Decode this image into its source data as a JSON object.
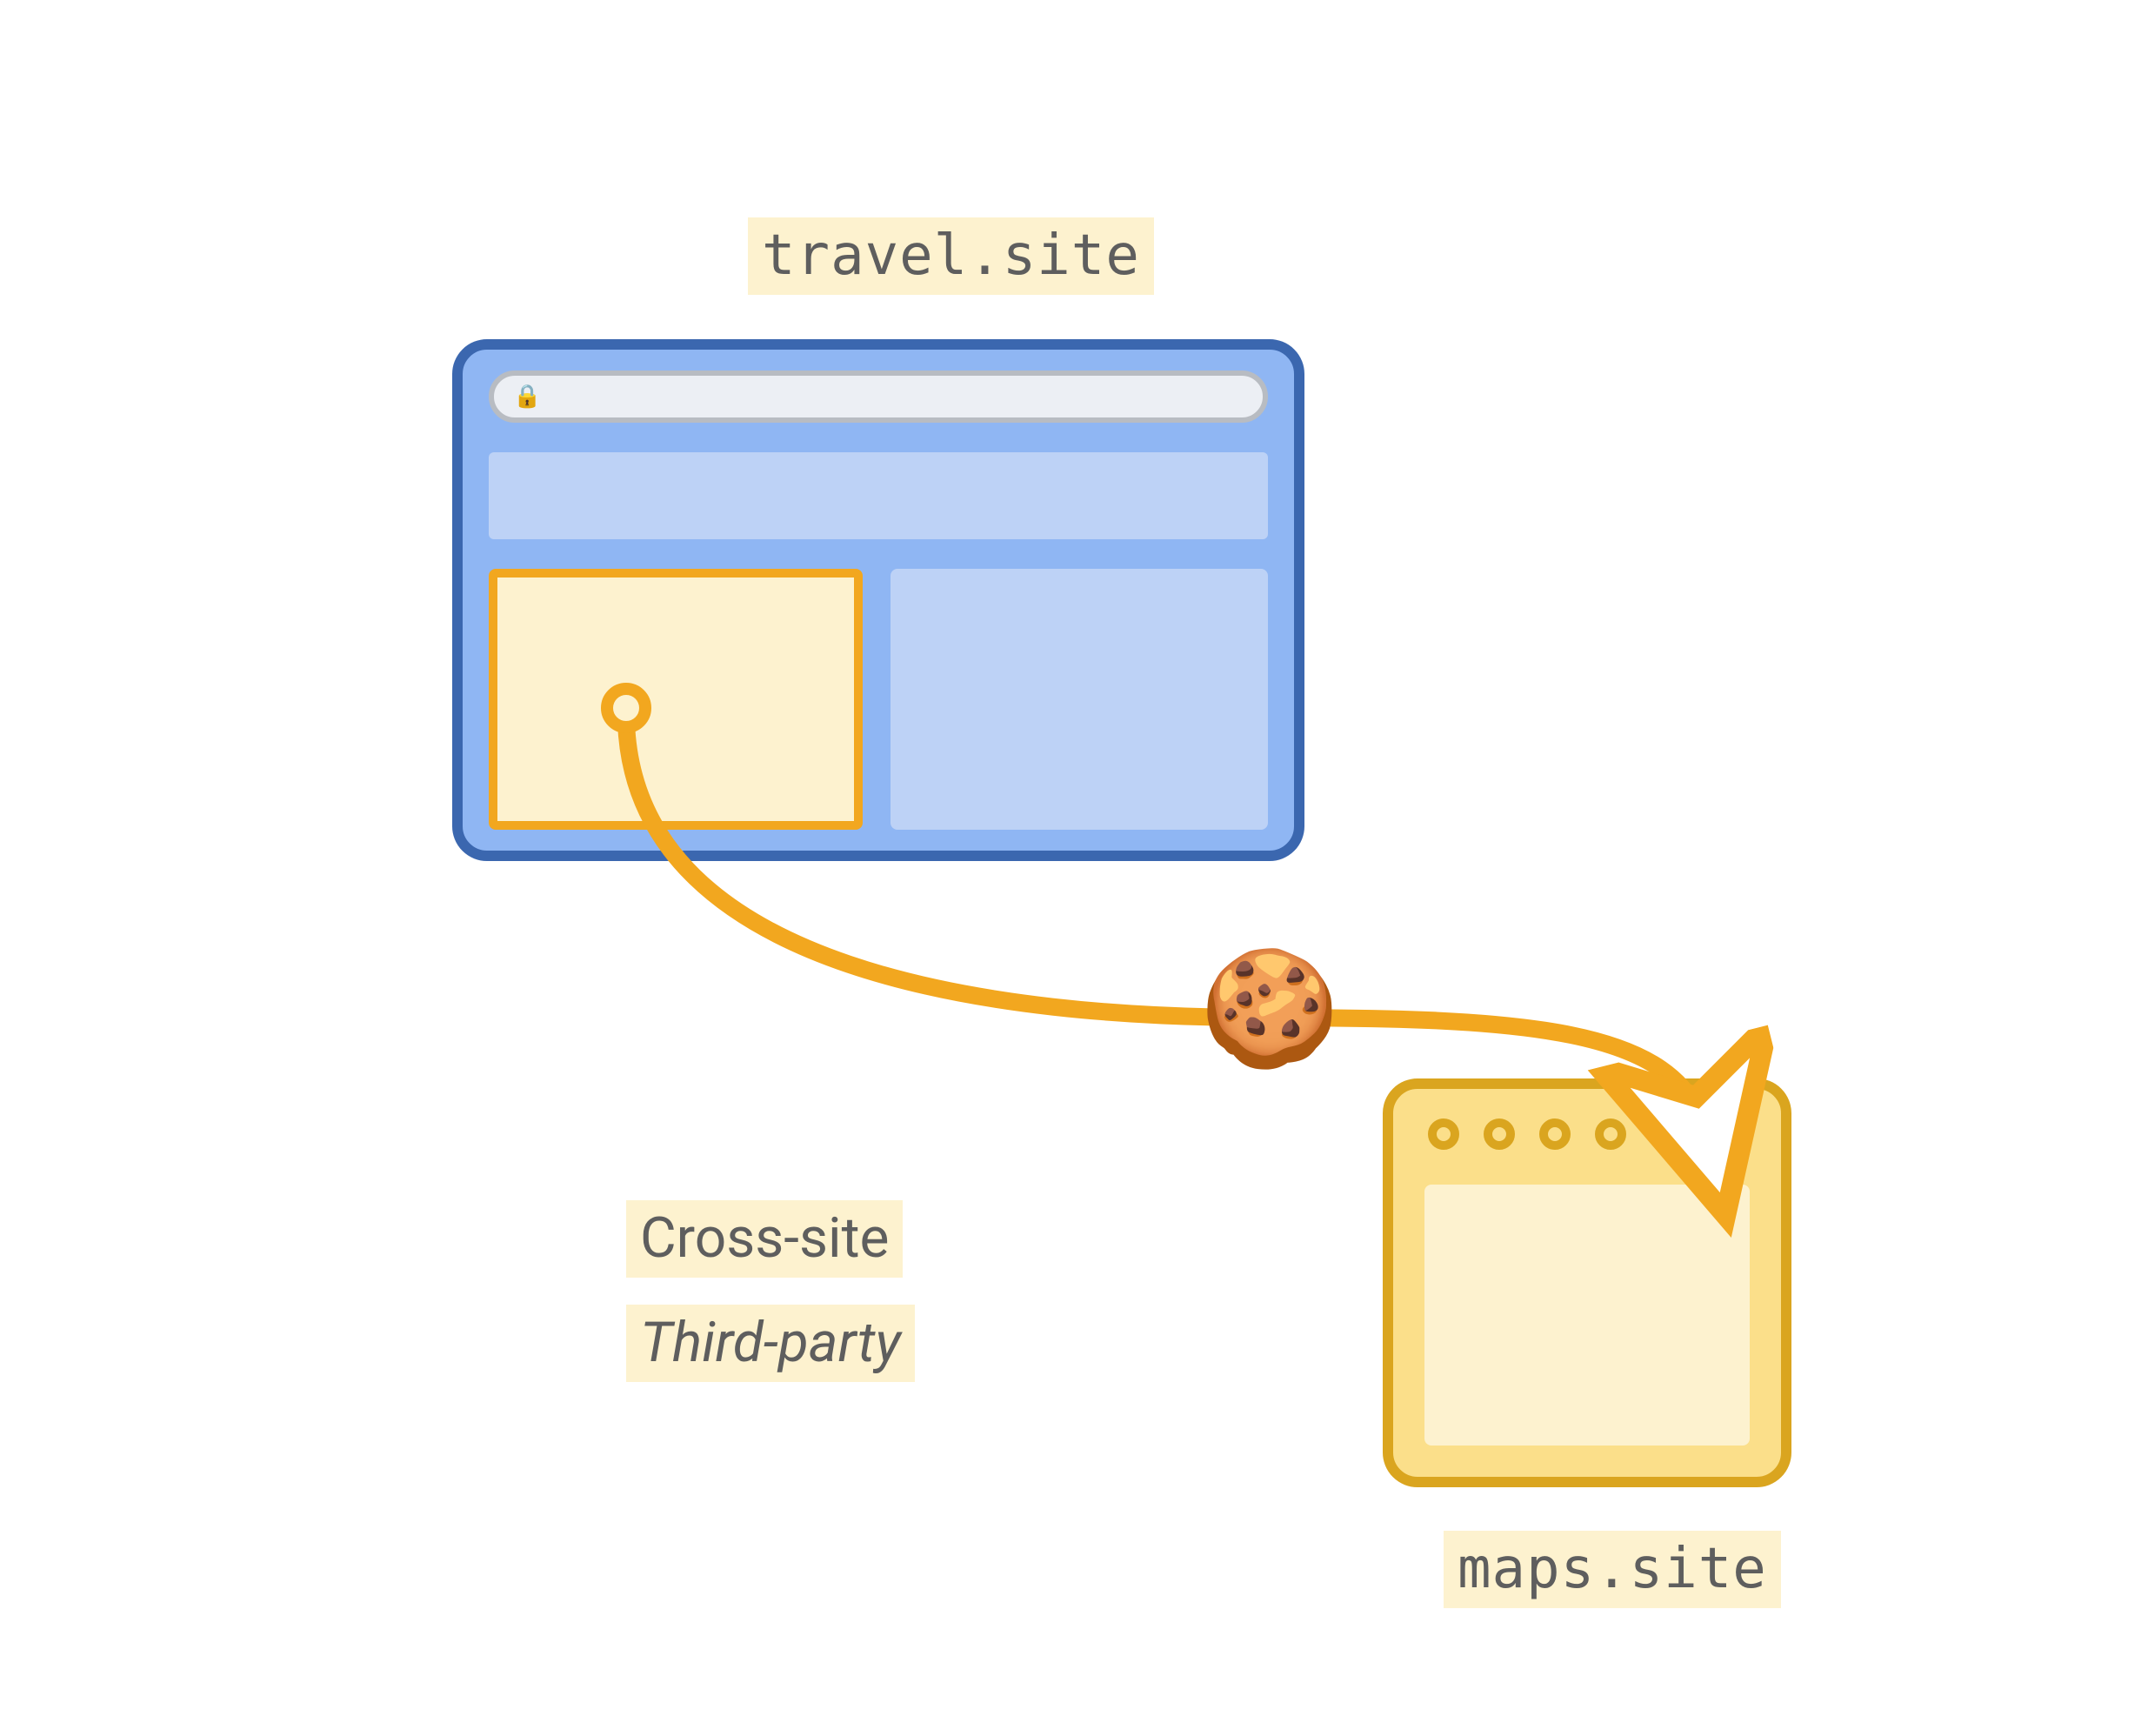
{
  "labels": {
    "top_site": "travel.site",
    "bottom_site": "maps.site",
    "desc1": "Cross-site",
    "desc2": "Third-party"
  },
  "icons": {
    "lock": "🔒",
    "cookie": "🍪"
  },
  "colors": {
    "browser_border": "#3b67af",
    "browser_fill": "#8fb6f3",
    "browser_panel": "#bdd2f6",
    "accent_border": "#f2a71f",
    "accent_fill": "#fdf2cf",
    "server_border": "#daa51f",
    "server_fill": "#fbdf8a",
    "label_bg": "#fdf2cf",
    "label_text": "#5e5e5e",
    "arrow": "#f2a71f"
  }
}
